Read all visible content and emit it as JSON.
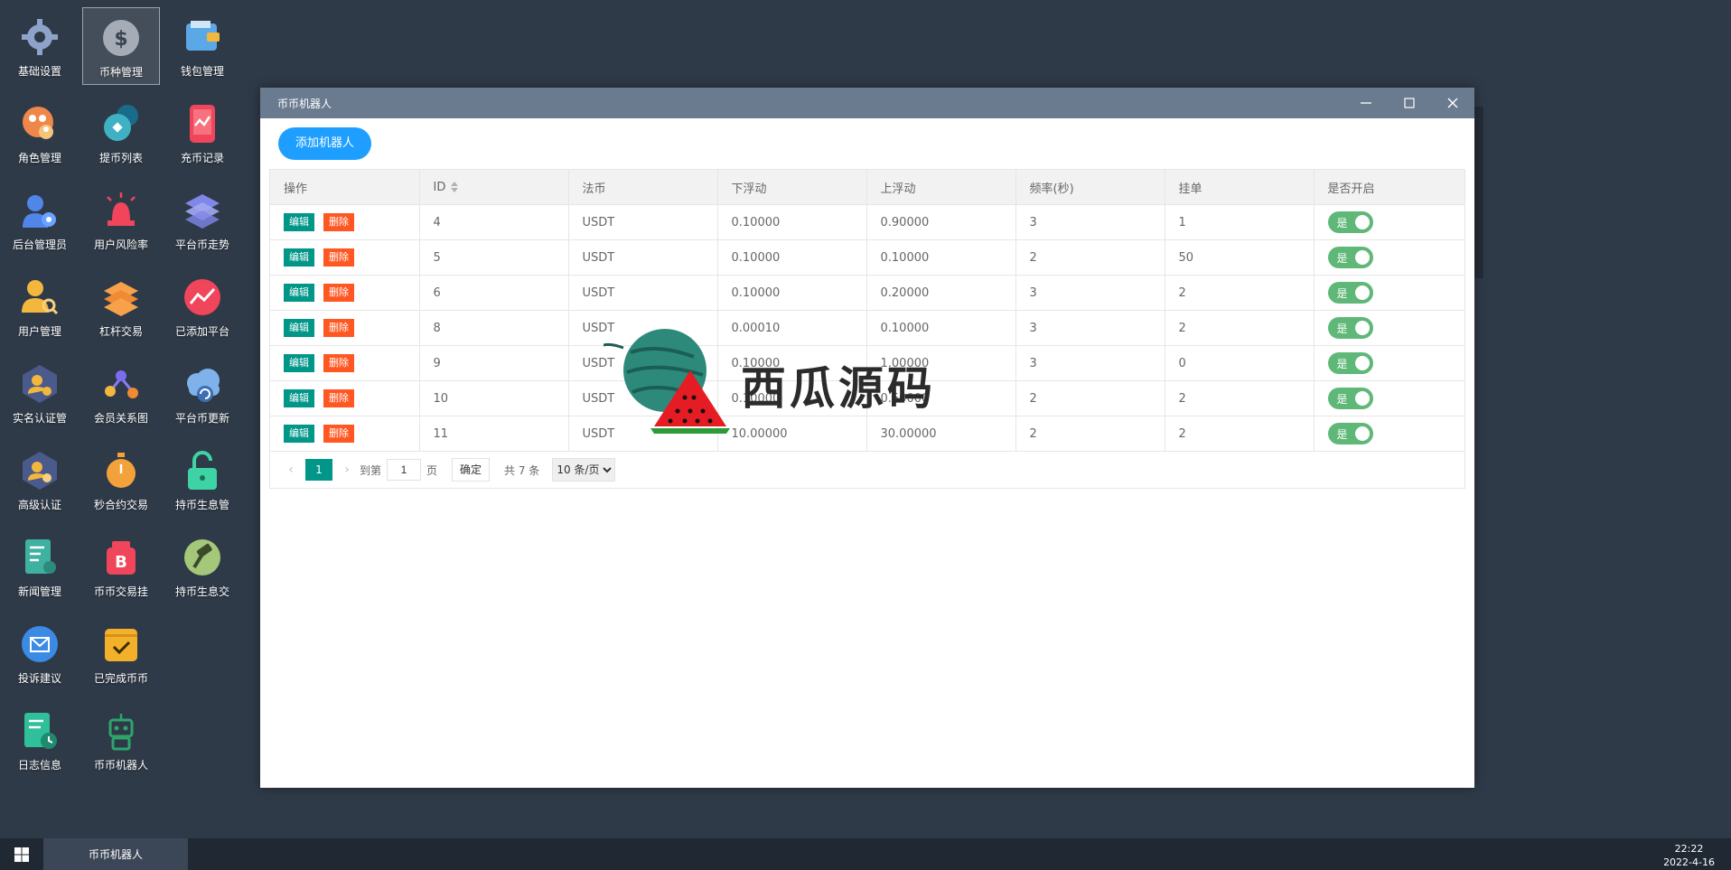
{
  "desktop": {
    "icons": [
      {
        "label": "基础设置",
        "icon": "gear-icon"
      },
      {
        "label": "币种管理",
        "icon": "dollar-icon"
      },
      {
        "label": "钱包管理",
        "icon": "wallet-icon"
      },
      {
        "label": "角色管理",
        "icon": "role-icon"
      },
      {
        "label": "提币列表",
        "icon": "withdraw-icon"
      },
      {
        "label": "充币记录",
        "icon": "recharge-icon"
      },
      {
        "label": "后台管理员",
        "icon": "admin-icon"
      },
      {
        "label": "用户风险率",
        "icon": "alarm-icon"
      },
      {
        "label": "平台币走势",
        "icon": "layers-icon"
      },
      {
        "label": "用户管理",
        "icon": "user-search-icon"
      },
      {
        "label": "杠杆交易",
        "icon": "stack-icon"
      },
      {
        "label": "已添加平台",
        "icon": "trend-icon"
      },
      {
        "label": "实名认证管",
        "icon": "verify-icon"
      },
      {
        "label": "会员关系图",
        "icon": "network-icon"
      },
      {
        "label": "平台币更新",
        "icon": "cloud-refresh-icon"
      },
      {
        "label": "高级认证",
        "icon": "advanced-verify-icon"
      },
      {
        "label": "秒合约交易",
        "icon": "stopwatch-icon"
      },
      {
        "label": "持币生息管",
        "icon": "unlock-icon"
      },
      {
        "label": "新闻管理",
        "icon": "news-icon"
      },
      {
        "label": "币币交易挂",
        "icon": "bitcoin-bag-icon"
      },
      {
        "label": "持币生息交",
        "icon": "hammer-icon"
      },
      {
        "label": "投诉建议",
        "icon": "mail-icon"
      },
      {
        "label": "已完成币币",
        "icon": "check-folder-icon"
      },
      {
        "label": "日志信息",
        "icon": "log-icon"
      },
      {
        "label": "币币机器人",
        "icon": "robot-icon"
      }
    ]
  },
  "window": {
    "title": "币币机器人",
    "add_button": "添加机器人",
    "columns": [
      "操作",
      "ID",
      "法币",
      "下浮动",
      "上浮动",
      "频率(秒)",
      "挂单",
      "是否开启"
    ],
    "edit_label": "编辑",
    "delete_label": "删除",
    "switch_label": "是",
    "rows": [
      {
        "id": "4",
        "fiat": "USDT",
        "down": "0.10000",
        "up": "0.90000",
        "freq": "3",
        "orders": "1",
        "enabled": true
      },
      {
        "id": "5",
        "fiat": "USDT",
        "down": "0.10000",
        "up": "0.10000",
        "freq": "2",
        "orders": "50",
        "enabled": true
      },
      {
        "id": "6",
        "fiat": "USDT",
        "down": "0.10000",
        "up": "0.20000",
        "freq": "3",
        "orders": "2",
        "enabled": true
      },
      {
        "id": "8",
        "fiat": "USDT",
        "down": "0.00010",
        "up": "0.10000",
        "freq": "3",
        "orders": "2",
        "enabled": true
      },
      {
        "id": "9",
        "fiat": "USDT",
        "down": "0.10000",
        "up": "1.00000",
        "freq": "3",
        "orders": "0",
        "enabled": true
      },
      {
        "id": "10",
        "fiat": "USDT",
        "down": "0.10000",
        "up": "0.50000",
        "freq": "2",
        "orders": "2",
        "enabled": true
      },
      {
        "id": "11",
        "fiat": "USDT",
        "down": "10.00000",
        "up": "30.00000",
        "freq": "2",
        "orders": "2",
        "enabled": true
      }
    ],
    "pager": {
      "current": "1",
      "goto_label": "到第",
      "goto_value": "1",
      "page_label": "页",
      "ok_label": "确定",
      "total": "共 7 条",
      "page_size": "10 条/页"
    }
  },
  "watermark": {
    "text": "西瓜源码"
  },
  "taskbar": {
    "task_label": "币币机器人",
    "time": "22:22",
    "date": "2022-4-16"
  }
}
